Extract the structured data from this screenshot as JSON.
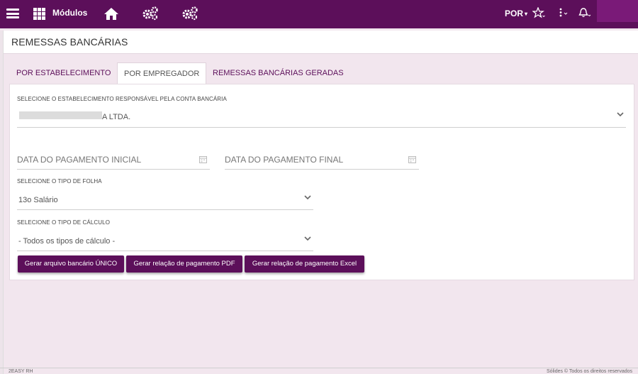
{
  "header": {
    "modules_label": "Módulos",
    "language": "POR",
    "icons": [
      "menu-icon",
      "grid-icon",
      "home-icon",
      "cogs-icon",
      "cogs-icon",
      "star-icon",
      "vertical-dots-icon",
      "bell-icon"
    ]
  },
  "page": {
    "title": "REMESSAS BANCÁRIAS"
  },
  "tabs": [
    {
      "label": "POR ESTABELECIMENTO",
      "active": false
    },
    {
      "label": "POR EMPREGADOR",
      "active": true
    },
    {
      "label": "REMESSAS BANCÁRIAS GERADAS",
      "active": false
    }
  ],
  "form": {
    "establishment_label": "SELECIONE O ESTABELECIMENTO RESPONSÁVEL PELA CONTA BANCÁRIA",
    "establishment_value": "A LTDA.",
    "date_start_placeholder": "DATA DO PAGAMENTO INICIAL",
    "date_end_placeholder": "DATA DO PAGAMENTO FINAL",
    "sheet_type_label": "SELECIONE O TIPO DE FOLHA",
    "sheet_type_value": "13o Salário",
    "calc_type_label": "SELECIONE O TIPO DE CÁLCULO",
    "calc_type_value": "- Todos os tipos de cálculo -"
  },
  "buttons": {
    "bank_file": "Gerar arquivo bancário ÚNICO",
    "payment_pdf": "Gerar relação de pagamento PDF",
    "payment_excel": "Gerar relação de pagamento Excel"
  },
  "footer": {
    "left": "2EASY RH",
    "right": "Sólides © Todos os direitos reservados"
  },
  "colors": {
    "primary": "#5c0f5a",
    "background": "#f2e6ee"
  }
}
